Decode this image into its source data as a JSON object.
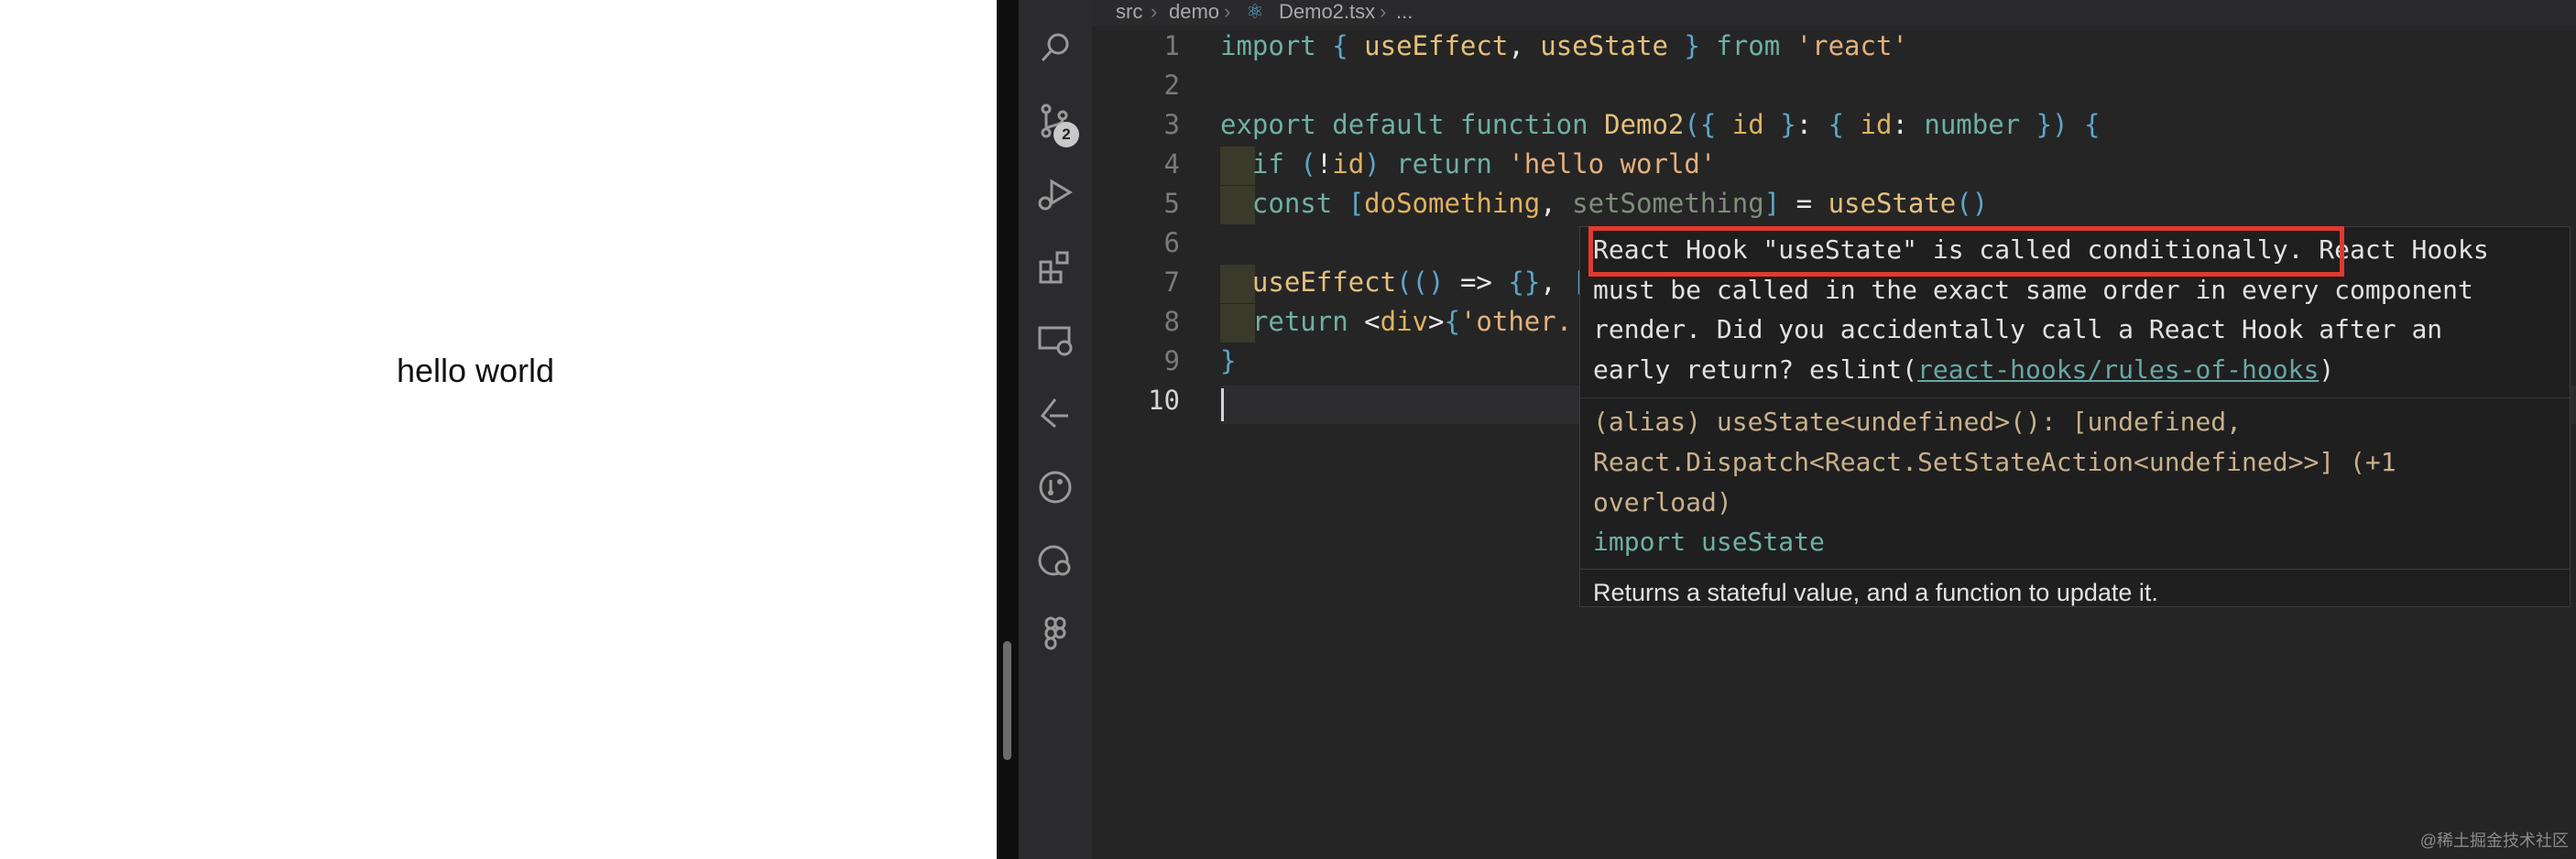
{
  "preview": {
    "text": "hello world"
  },
  "breadcrumb": {
    "segments": [
      "src",
      "demo",
      "Demo2.tsx",
      "..."
    ]
  },
  "activity_bar": {
    "icons": [
      "search-icon",
      "source-control-icon",
      "run-debug-icon",
      "extensions-icon",
      "remote-explorer-icon",
      "test-icon",
      "git-graph-icon",
      "settings-sync-icon",
      "figma-icon"
    ],
    "scm_badge": "2"
  },
  "editor": {
    "line_numbers": [
      "1",
      "2",
      "3",
      "4",
      "5",
      "6",
      "7",
      "8",
      "9",
      "10"
    ],
    "current_line": "10",
    "lines": [
      "import { useEffect, useState } from 'react'",
      "",
      "export default function Demo2({ id }: { id: number }) {",
      "  if (!id) return 'hello world'",
      "  const [doSomething, setSomething] = useState()",
      "",
      "  useEffect(() => {}, [])",
      "  return <div>{'other.",
      "}",
      ""
    ]
  },
  "hover": {
    "message_highlight": "React Hook \"useState\" is called conditionally.",
    "message_rest_1": " React Hooks",
    "message_line_2": "must be called in the exact same order in every component",
    "message_line_3": "render. Did you accidentally call a React Hook after an",
    "message_line_4_text": "early return? eslint(",
    "message_rule": "react-hooks/rules-of-hooks",
    "message_line_4_end": ")",
    "signature_1": "(alias) useState<undefined>(): [undefined,",
    "signature_2": "React.Dispatch<React.SetStateAction<undefined>>] (+1",
    "signature_3": "overload)",
    "signature_4": "import useState",
    "description": "Returns a stateful value, and a function to update it."
  },
  "watermark": "@稀土掘金技术社区",
  "colors": {
    "highlight_border": "#e03a2f",
    "editor_bg": "#252526"
  }
}
